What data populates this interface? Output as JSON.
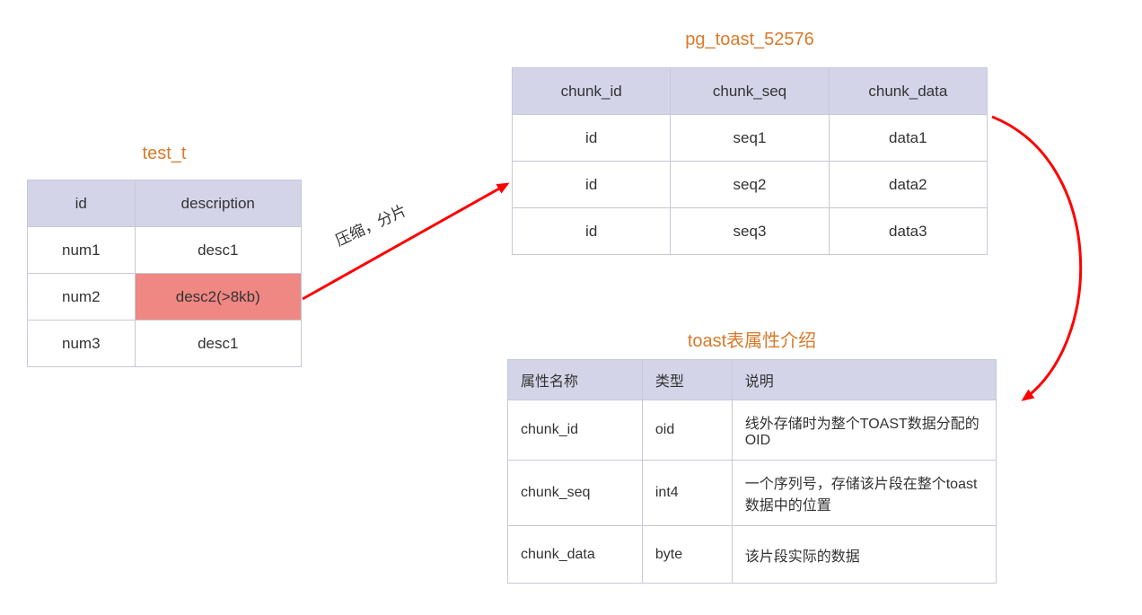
{
  "colors": {
    "title": "#d87a2a",
    "header_bg": "#d3d4e8",
    "highlight": "#ef8783",
    "arrow": "#ff0000",
    "border": "#c8c8d8"
  },
  "arrow_label": "压缩，分片",
  "test_t": {
    "title": "test_t",
    "headers": [
      "id",
      "description"
    ],
    "rows": [
      {
        "id": "num1",
        "desc": "desc1",
        "highlight": false
      },
      {
        "id": "num2",
        "desc": "desc2(>8kb)",
        "highlight": true
      },
      {
        "id": "num3",
        "desc": "desc1",
        "highlight": false
      }
    ]
  },
  "toast": {
    "title": "pg_toast_52576",
    "headers": [
      "chunk_id",
      "chunk_seq",
      "chunk_data"
    ],
    "rows": [
      {
        "chunk_id": "id",
        "chunk_seq": "seq1",
        "chunk_data": "data1"
      },
      {
        "chunk_id": "id",
        "chunk_seq": "seq2",
        "chunk_data": "data2"
      },
      {
        "chunk_id": "id",
        "chunk_seq": "seq3",
        "chunk_data": "data3"
      }
    ]
  },
  "attrs": {
    "title": "toast表属性介绍",
    "headers": [
      "属性名称",
      "类型",
      "说明"
    ],
    "rows": [
      {
        "name": "chunk_id",
        "type": "oid",
        "desc": "线外存储时为整个TOAST数据分配的OID"
      },
      {
        "name": "chunk_seq",
        "type": "int4",
        "desc": "一个序列号，存储该片段在整个toast数据中的位置"
      },
      {
        "name": "chunk_data",
        "type": "byte",
        "desc": "该片段实际的数据"
      }
    ]
  }
}
